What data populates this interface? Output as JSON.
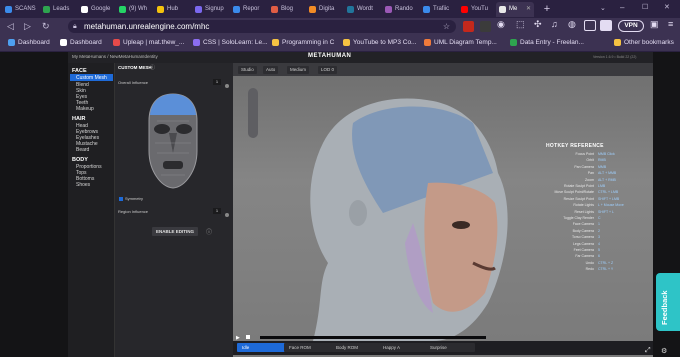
{
  "browser": {
    "tabs": [
      {
        "label": "SCANS",
        "active": false
      },
      {
        "label": "Leads",
        "active": false
      },
      {
        "label": "Google",
        "active": false
      },
      {
        "label": "(9) Wh",
        "active": false
      },
      {
        "label": "Hub",
        "active": false
      },
      {
        "label": "Signup",
        "active": false
      },
      {
        "label": "Repor",
        "active": false
      },
      {
        "label": "Blog",
        "active": false
      },
      {
        "label": "Digita",
        "active": false
      },
      {
        "label": "Wordt",
        "active": false
      },
      {
        "label": "Rando",
        "active": false
      },
      {
        "label": "Trafiic",
        "active": false
      },
      {
        "label": "YouTu",
        "active": false
      },
      {
        "label": "Me",
        "active": true
      }
    ],
    "new_tab_label": "+",
    "url": "metahuman.unrealengine.com/mhc",
    "vpn_label": "VPN",
    "bookmarks": [
      "Dashboard",
      "Dashboard",
      "Upleap | mat.thew_...",
      "CSS | SoloLearn: Le...",
      "Programming in C",
      "YouTube to MP3 Co...",
      "UML Diagram Temp...",
      "Data Entry - Freelan..."
    ],
    "other_bookmarks": "Other bookmarks"
  },
  "app": {
    "breadcrumb": "My MetaHumans / NewMetaHumanIdentity",
    "logo": "METAHUMAN",
    "version_info": "Version 1.6.9 • Build 22 (22)",
    "panel_title": "CUSTOM MESH",
    "overall_influence_label": "Overall Influence",
    "overall_influence_value": "1",
    "symmetry_label": "Symmetry",
    "region_influence_label": "Region Influence",
    "region_influence_value": "1",
    "enable_editing_label": "ENABLE EDITING",
    "view_buttons": [
      "Studio",
      "Auto",
      "Medium",
      "LOD 0"
    ],
    "nav": {
      "face_header": "FACE",
      "face_items": [
        "Custom Mesh",
        "Blend",
        "Skin",
        "Eyes",
        "Teeth",
        "Makeup"
      ],
      "hair_header": "HAIR",
      "hair_items": [
        "Head",
        "Eyebrows",
        "Eyelashes",
        "Mustache",
        "Beard"
      ],
      "body_header": "BODY",
      "body_items": [
        "Proportions",
        "Tops",
        "Bottoms",
        "Shoes"
      ]
    },
    "hotkeys": {
      "title": "HOTKEY REFERENCE",
      "items": [
        {
          "key": "Focus Point",
          "value": "MMB Click"
        },
        {
          "key": "Orbit",
          "value": "RMB"
        },
        {
          "key": "Pan Camera",
          "value": "MMB"
        },
        {
          "key": "Pan",
          "value": "ALT + MMB"
        },
        {
          "key": "Zoom",
          "value": "ALT + RMB"
        },
        {
          "key": "Rotate Sculpt Point",
          "value": "LMB"
        },
        {
          "key": "Move Sculpt Point/Rotate",
          "value": "CTRL + LMB"
        },
        {
          "key": "Resize Sculpt Point",
          "value": "SHIFT + LMB"
        },
        {
          "key": "Rotate Lights",
          "value": "L + Mouse Move"
        },
        {
          "key": "Reset Lights",
          "value": "SHIFT + L"
        },
        {
          "key": "Toggle Clay Render",
          "value": "C"
        },
        {
          "key": "Face Camera",
          "value": "1"
        },
        {
          "key": "Body Camera",
          "value": "2"
        },
        {
          "key": "Torso Camera",
          "value": "3"
        },
        {
          "key": "Legs Camera",
          "value": "4"
        },
        {
          "key": "Feet Camera",
          "value": "5"
        },
        {
          "key": "Far Camera",
          "value": "6"
        },
        {
          "key": "Undo",
          "value": "CTRL + Z"
        },
        {
          "key": "Redo",
          "value": "CTRL + Y"
        }
      ]
    },
    "anim_buttons": [
      "Idle",
      "Face ROM",
      "Body ROM",
      "Happy A",
      "Surprise"
    ],
    "feedback_label": "Feedback"
  },
  "colors": {
    "browser_bg": "#2a2140",
    "toolbar_bg": "#3c3252",
    "accent_blue": "#1e6ad8",
    "feedback": "#2ec4c7",
    "hotkey_value": "#9fd0ff"
  }
}
